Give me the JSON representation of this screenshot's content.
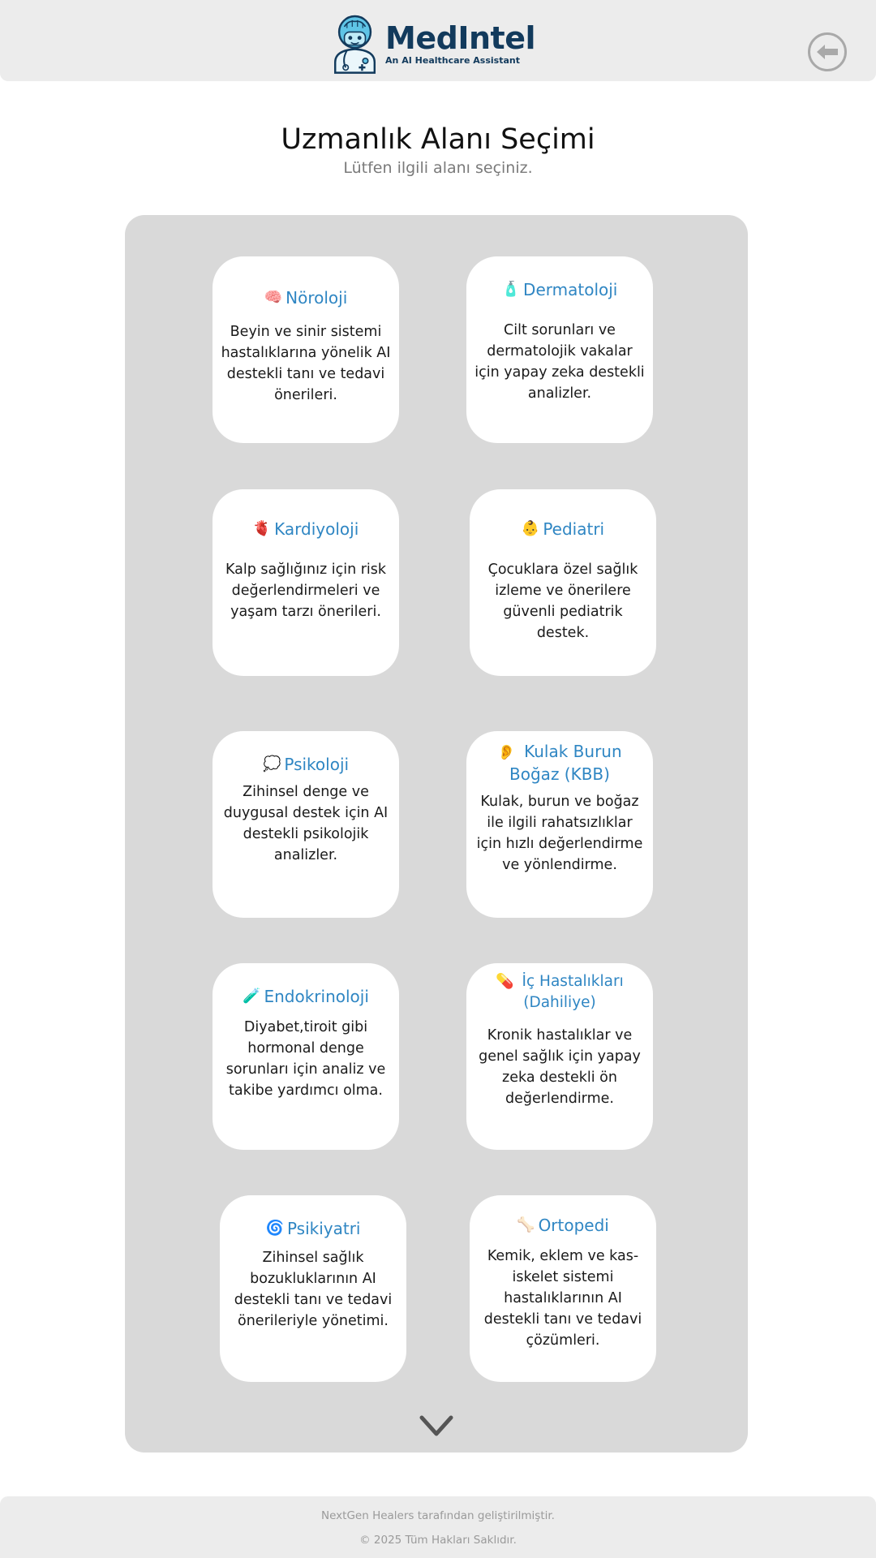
{
  "header": {
    "brand": "MedIntel",
    "tagline": "An AI Healthcare Assistant",
    "back_icon": "arrow-left-circle-icon"
  },
  "page": {
    "title": "Uzmanlık Alanı Seçimi",
    "subtitle": "Lütfen ilgili alanı seçiniz."
  },
  "cards": [
    {
      "emoji": "🧠",
      "title": "Nöroloji",
      "desc": "Beyin ve sinir sistemi hastalıklarına yönelik AI destekli tanı ve tedavi önerileri."
    },
    {
      "emoji": "🧴",
      "title": "Dermatoloji",
      "desc": "Cilt sorunları ve dermatolojik vakalar için yapay zeka destekli analizler."
    },
    {
      "emoji": "🫀",
      "title": "Kardiyoloji",
      "desc": "Kalp sağlığınız için risk değerlendirmeleri ve yaşam tarzı önerileri."
    },
    {
      "emoji": "👶",
      "title": "Pediatri",
      "desc": "Çocuklara özel sağlık izleme ve önerilere güvenli pediatrik destek."
    },
    {
      "emoji": "💭",
      "title": "Psikoloji",
      "desc": "Zihinsel denge ve duygusal destek için AI destekli psikolojik analizler."
    },
    {
      "emoji": "👂",
      "title": "Kulak Burun Boğaz (KBB)",
      "desc": "Kulak, burun ve boğaz ile ilgili rahatsızlıklar için hızlı değerlendirme ve yönlendirme."
    },
    {
      "emoji": "🧪",
      "title": "Endokrinoloji",
      "desc": "Diyabet,tiroit gibi hormonal denge sorunları için analiz ve takibe yardımcı olma."
    },
    {
      "emoji": "💊",
      "title": "İç Hastalıkları (Dahiliye)",
      "desc": "Kronik hastalıklar ve genel sağlık için yapay zeka destekli ön değerlendirme."
    },
    {
      "emoji": "🌀",
      "title": "Psikiyatri",
      "desc": "Zihinsel sağlık bozukluklarının AI destekli tanı ve tedavi önerileriyle yönetimi."
    },
    {
      "emoji": "🦴",
      "title": "Ortopedi",
      "desc": "Kemik, eklem ve kas-iskelet sistemi hastalıklarının AI destekli tanı ve tedavi çözümleri."
    }
  ],
  "scroll_icon": "chevron-down-icon",
  "footer": {
    "line1": "NextGen Healers tarafından geliştirilmiştir.",
    "line2": "© 2025 Tüm Hakları Saklıdır."
  },
  "colors": {
    "accent": "#2f86c3",
    "brand": "#123a5c",
    "panel": "#d9d9d9",
    "header_bg": "#ececec"
  }
}
